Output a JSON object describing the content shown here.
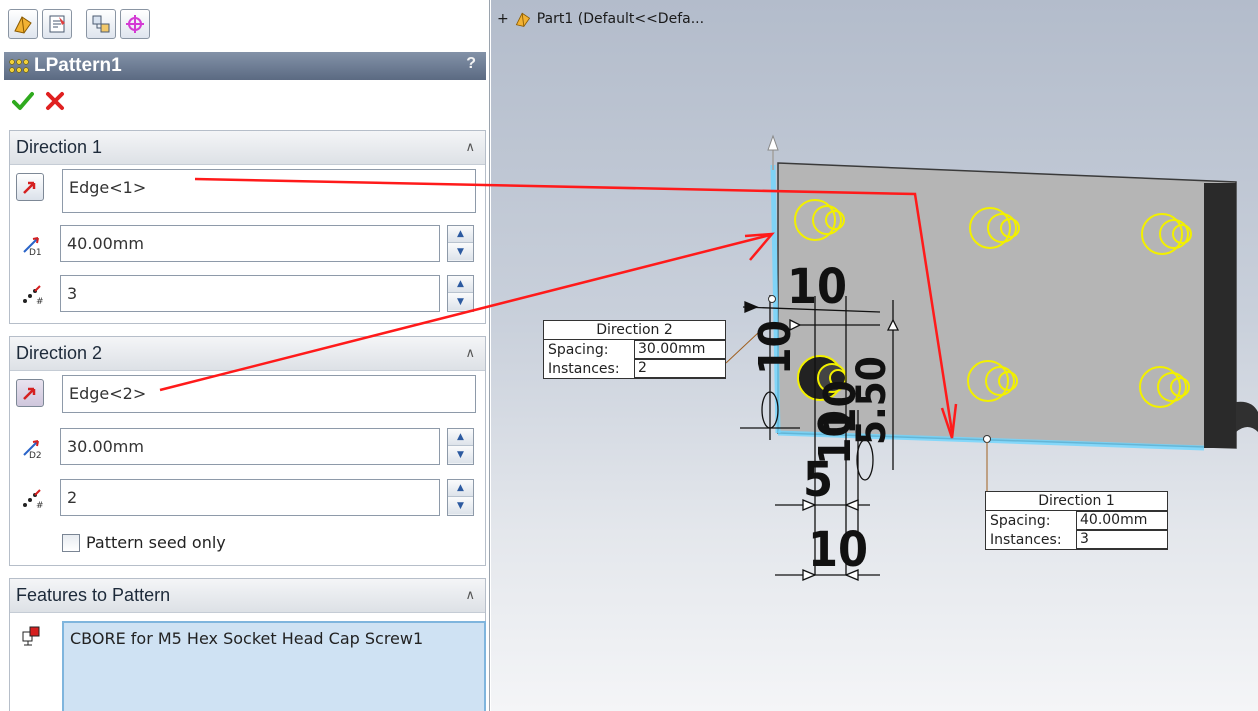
{
  "panel": {
    "tabs": [
      "feature-manager-tab",
      "property-manager-tab",
      "configuration-manager-tab",
      "dimxpert-manager-tab"
    ],
    "title": "LPattern1",
    "help": "?",
    "direction1": {
      "header": "Direction 1",
      "edge": "Edge<1>",
      "spacing": "40.00mm",
      "instances": "3"
    },
    "direction2": {
      "header": "Direction 2",
      "edge": "Edge<2>",
      "spacing": "30.00mm",
      "instances": "2",
      "seed_only_label": "Pattern seed only"
    },
    "features": {
      "header": "Features to Pattern",
      "items": [
        "CBORE for M5 Hex Socket Head Cap Screw1"
      ]
    }
  },
  "viewport": {
    "tree_label": "Part1  (Default<<Defa...",
    "dimensions": [
      "10",
      "10",
      "10",
      "5.50",
      "10",
      "5",
      "10"
    ],
    "callout_dir2": {
      "title": "Direction 2",
      "spacing_label": "Spacing:",
      "spacing": "30.00mm",
      "instances_label": "Instances:",
      "instances": "2"
    },
    "callout_dir1": {
      "title": "Direction 1",
      "spacing_label": "Spacing:",
      "spacing": "40.00mm",
      "instances_label": "Instances:",
      "instances": "3"
    }
  },
  "colors": {
    "annotation": "#ff1a1a",
    "highlight_edge": "#6fd6ff",
    "hole_preview": "#f2f000",
    "title_bar": "#5b6a82"
  }
}
